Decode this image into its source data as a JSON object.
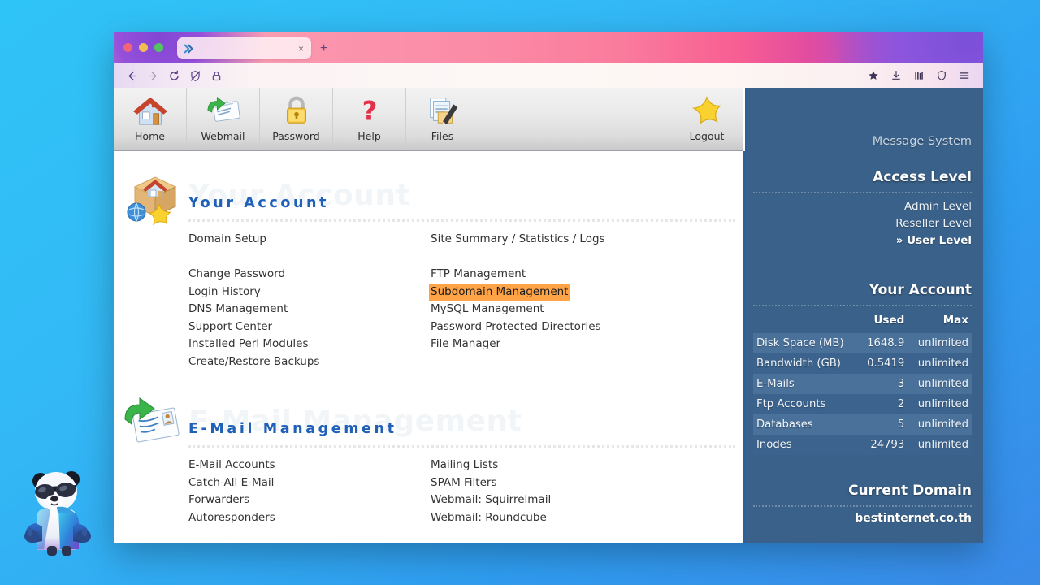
{
  "browser": {
    "tab": {
      "title": "",
      "favicon": "directadmin-logo-icon",
      "close_label": "×"
    },
    "new_tab_label": "+",
    "nav": {
      "back": "back-arrow-icon",
      "forward": "forward-arrow-icon",
      "reload": "reload-icon",
      "shield_off": "shield-off-icon",
      "lock": "lock-icon"
    },
    "toolbar_right": [
      "bookmark-star-icon",
      "downloads-icon",
      "library-icon",
      "shield-icon",
      "menu-icon"
    ]
  },
  "da_toolbar": {
    "items": [
      {
        "label": "Home",
        "icon": "house-icon"
      },
      {
        "label": "Webmail",
        "icon": "envelope-arrow-icon"
      },
      {
        "label": "Password",
        "icon": "padlock-icon"
      },
      {
        "label": "Help",
        "icon": "question-mark-icon"
      },
      {
        "label": "Files",
        "icon": "documents-pen-icon"
      },
      {
        "label": "Logout",
        "icon": "star-icon"
      }
    ]
  },
  "sections": [
    {
      "title": "Your Account",
      "watermark": "Your Account",
      "icon": "box-house-globe-star-icon",
      "col_left": [
        {
          "label": "Domain Setup",
          "highlighted": false
        },
        {
          "label": "",
          "spacer": true
        },
        {
          "label": "Change Password",
          "highlighted": false
        },
        {
          "label": "Login History",
          "highlighted": false
        },
        {
          "label": "DNS Management",
          "highlighted": false
        },
        {
          "label": "Support Center",
          "highlighted": false
        },
        {
          "label": "Installed Perl Modules",
          "highlighted": false
        },
        {
          "label": "Create/Restore Backups",
          "highlighted": false
        }
      ],
      "col_right": [
        {
          "label": "Site Summary / Statistics / Logs",
          "highlighted": false
        },
        {
          "label": "",
          "spacer": true
        },
        {
          "label": "FTP Management",
          "highlighted": false
        },
        {
          "label": "Subdomain Management",
          "highlighted": true
        },
        {
          "label": "MySQL Management",
          "highlighted": false
        },
        {
          "label": "Password Protected Directories",
          "highlighted": false
        },
        {
          "label": "File Manager",
          "highlighted": false
        }
      ]
    },
    {
      "title": "E-Mail Management",
      "watermark": "E-Mail Management",
      "icon": "envelope-green-arrow-icon",
      "col_left": [
        {
          "label": "E-Mail Accounts",
          "highlighted": false
        },
        {
          "label": "Catch-All E-Mail",
          "highlighted": false
        },
        {
          "label": "Forwarders",
          "highlighted": false
        },
        {
          "label": "Autoresponders",
          "highlighted": false
        }
      ],
      "col_right": [
        {
          "label": "Mailing Lists",
          "highlighted": false
        },
        {
          "label": "SPAM Filters",
          "highlighted": false
        },
        {
          "label": "Webmail: Squirrelmail",
          "highlighted": false
        },
        {
          "label": "Webmail: Roundcube",
          "highlighted": false
        }
      ]
    }
  ],
  "sidebar": {
    "message_system": "Message System",
    "access_level": {
      "heading": "Access Level",
      "levels": [
        {
          "label": "Admin Level",
          "active": false
        },
        {
          "label": "Reseller Level",
          "active": false
        },
        {
          "label": "» User Level",
          "active": true
        }
      ]
    },
    "your_account": {
      "heading": "Your Account",
      "columns": [
        "Used",
        "Max"
      ],
      "rows": [
        {
          "name": "Disk Space (MB)",
          "used": "1648.9",
          "max": "unlimited"
        },
        {
          "name": "Bandwidth (GB)",
          "used": "0.5419",
          "max": "unlimited"
        },
        {
          "name": "E-Mails",
          "used": "3",
          "max": "unlimited"
        },
        {
          "name": "Ftp Accounts",
          "used": "2",
          "max": "unlimited"
        },
        {
          "name": "Databases",
          "used": "5",
          "max": "unlimited"
        },
        {
          "name": "Inodes",
          "used": "24793",
          "max": "unlimited"
        }
      ]
    },
    "current_domain": {
      "heading": "Current Domain",
      "value": "bestinternet.co.th"
    }
  },
  "colors": {
    "accent_blue": "#1f60b8",
    "sidebar_bg": "#3a6189",
    "highlight_orange": "#ffa347",
    "page_bg_start": "#2fc4f7",
    "page_bg_end": "#3a8ae8"
  }
}
